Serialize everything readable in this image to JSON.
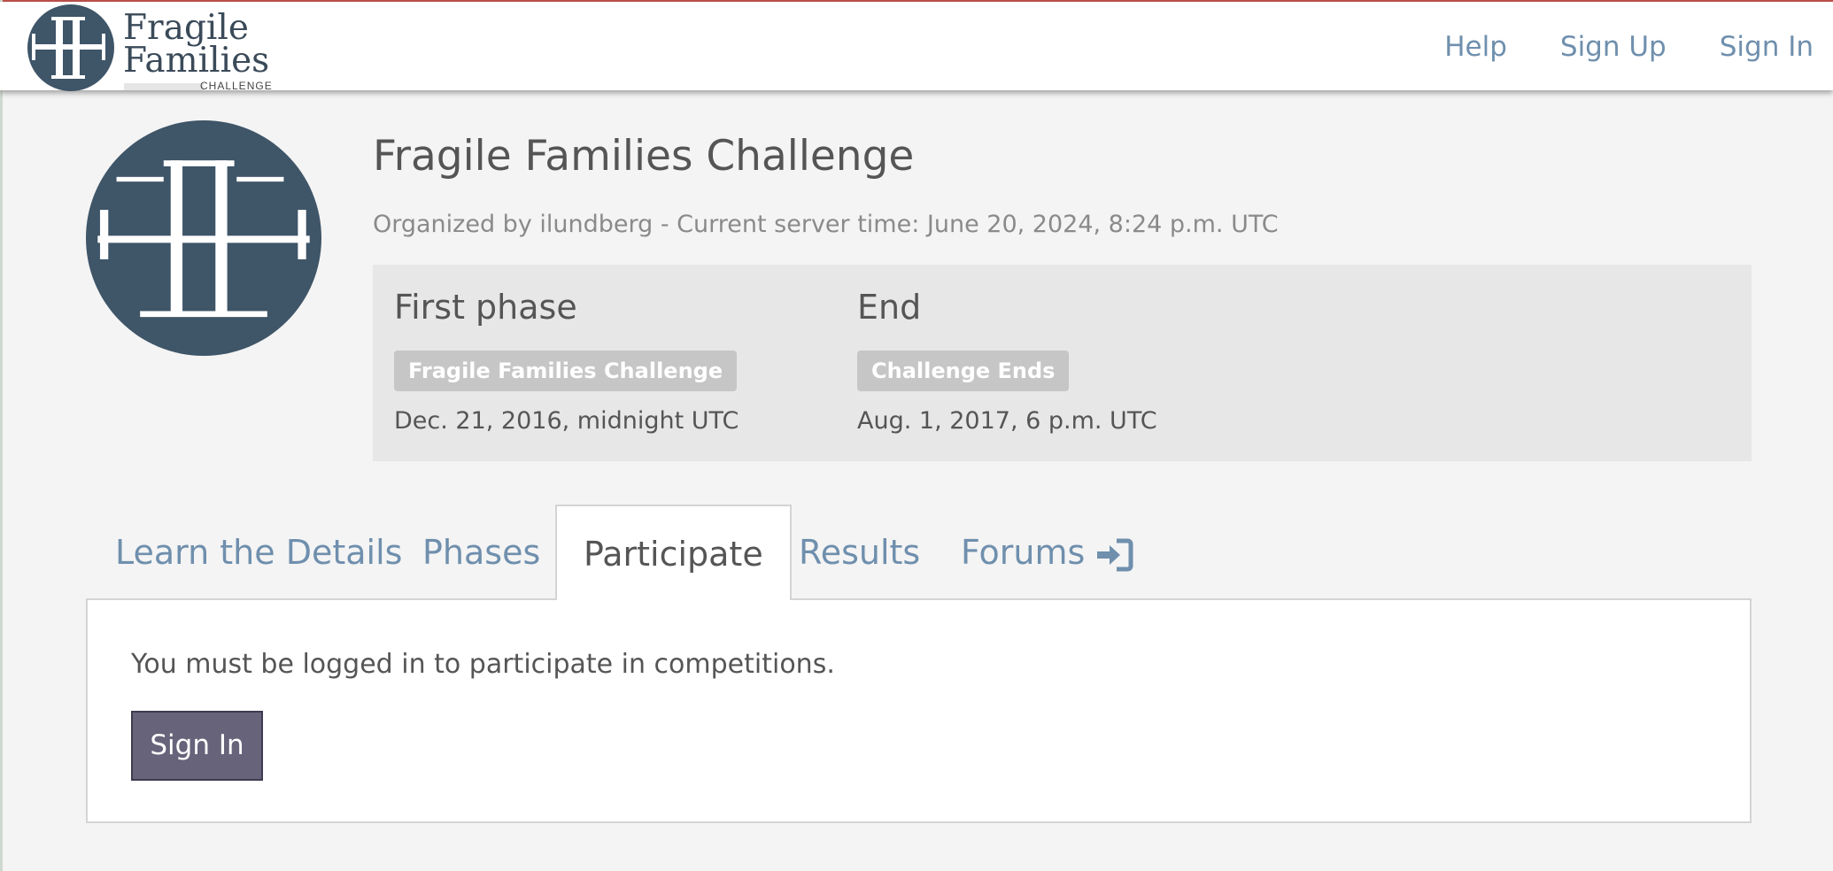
{
  "header": {
    "brand": {
      "line1": "Fragile",
      "line2": "Families",
      "sub": "CHALLENGE"
    },
    "nav": {
      "help": "Help",
      "signup": "Sign Up",
      "signin": "Sign In"
    }
  },
  "competition": {
    "title": "Fragile Families Challenge",
    "organizer_line": "Organized by ilundberg - Current server time: June 20, 2024, 8:24 p.m. UTC",
    "phases": [
      {
        "name": "First phase",
        "badge": "Fragile Families Challenge",
        "date": "Dec. 21, 2016, midnight UTC"
      },
      {
        "name": "End",
        "badge": "Challenge Ends",
        "date": "Aug. 1, 2017, 6 p.m. UTC"
      }
    ]
  },
  "tabs": {
    "details": "Learn the Details",
    "phases": "Phases",
    "participate": "Participate",
    "results": "Results",
    "forums": "Forums",
    "active": "Participate"
  },
  "participate": {
    "message": "You must be logged in to participate in competitions.",
    "signin_button": "Sign In"
  },
  "colors": {
    "link": "#6f8fad",
    "logo": "#3f5568",
    "badge": "#c6c6c6",
    "button": "#67637a"
  },
  "icons": [
    "ff-logo-icon",
    "sign-in-icon"
  ]
}
